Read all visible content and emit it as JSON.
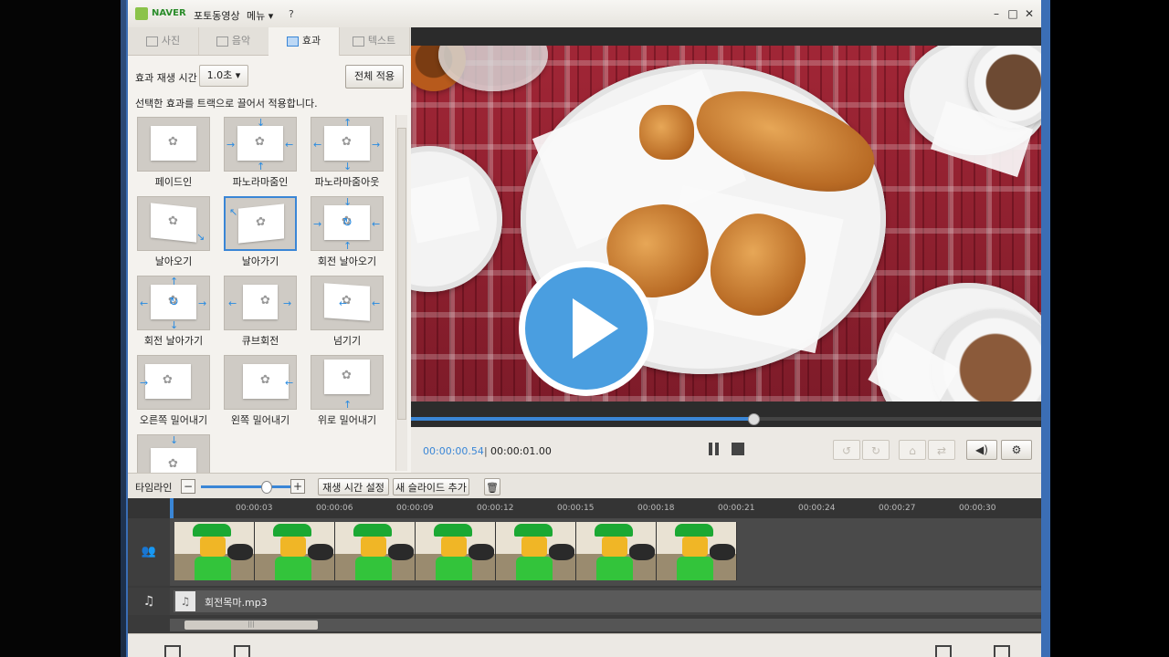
{
  "titlebar": {
    "brand": "NAVER",
    "app_title": "포토동영상",
    "menu_label": "메뉴 ▾",
    "help_label": "?",
    "minimize": "–",
    "maximize": "□",
    "close": "✕"
  },
  "tabs": [
    {
      "label": "사진",
      "icon": "photo-icon",
      "active": false
    },
    {
      "label": "음악",
      "icon": "music-icon",
      "active": false
    },
    {
      "label": "효과",
      "icon": "effect-icon",
      "active": true
    },
    {
      "label": "텍스트",
      "icon": "text-icon",
      "active": false
    }
  ],
  "effects_panel": {
    "duration_label": "효과 재생 시간",
    "duration_value": "1.0초 ▾",
    "apply_all_label": "전체 적용",
    "hint": "선택한 효과를 트랙으로 끌어서 적용합니다.",
    "items": [
      {
        "label": "페이드인"
      },
      {
        "label": "파노라마줌인"
      },
      {
        "label": "파노라마줌아웃"
      },
      {
        "label": "날아오기"
      },
      {
        "label": "날아가기",
        "selected": true
      },
      {
        "label": "회전 날아오기"
      },
      {
        "label": "회전 날아가기"
      },
      {
        "label": "큐브회전"
      },
      {
        "label": "넘기기"
      },
      {
        "label": "오른쪽 밀어내기"
      },
      {
        "label": "왼쪽 밀어내기"
      },
      {
        "label": "위로 밀어내기"
      }
    ]
  },
  "player": {
    "current_time": "00:00:00.54",
    "separator": "|",
    "total_time": "00:00:01.00",
    "progress": 0.54,
    "volume_icon": "volume-icon",
    "settings_icon": "gear-icon"
  },
  "timeline": {
    "label": "타임라인",
    "zoom_out": "−",
    "zoom_in": "+",
    "set_duration_label": "재생 시간 설정",
    "add_slide_label": "새 슬라이드 추가",
    "ticks": [
      "00:00:03",
      "00:00:06",
      "00:00:09",
      "00:00:12",
      "00:00:15",
      "00:00:18",
      "00:00:21",
      "00:00:24",
      "00:00:27",
      "00:00:30"
    ],
    "audio_clip_name": "회전목마.mp3",
    "accent_color": "#3a86d6"
  }
}
